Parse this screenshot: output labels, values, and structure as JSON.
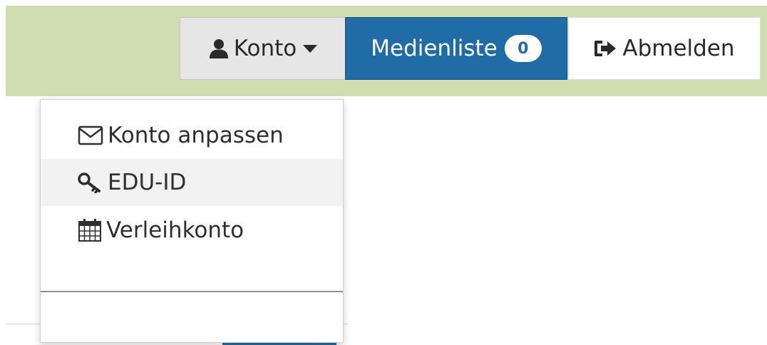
{
  "topbar": {
    "konto": {
      "label": "Konto",
      "icon": "user-icon",
      "caret_icon": "caret-down-icon"
    },
    "medienliste": {
      "label": "Medienliste",
      "count": "0"
    },
    "abmelden": {
      "label": "Abmelden",
      "icon": "sign-out-icon"
    }
  },
  "dropdown": {
    "items": [
      {
        "label": "Konto anpassen",
        "icon": "envelope-icon"
      },
      {
        "label": "EDU-ID",
        "icon": "key-icon"
      },
      {
        "label": "Verleihkonto",
        "icon": "calendar-icon"
      }
    ]
  },
  "colors": {
    "topbar_bg": "#d0ddb0",
    "primary": "#1f6ca6",
    "hover_bg": "#f2f2f2"
  }
}
